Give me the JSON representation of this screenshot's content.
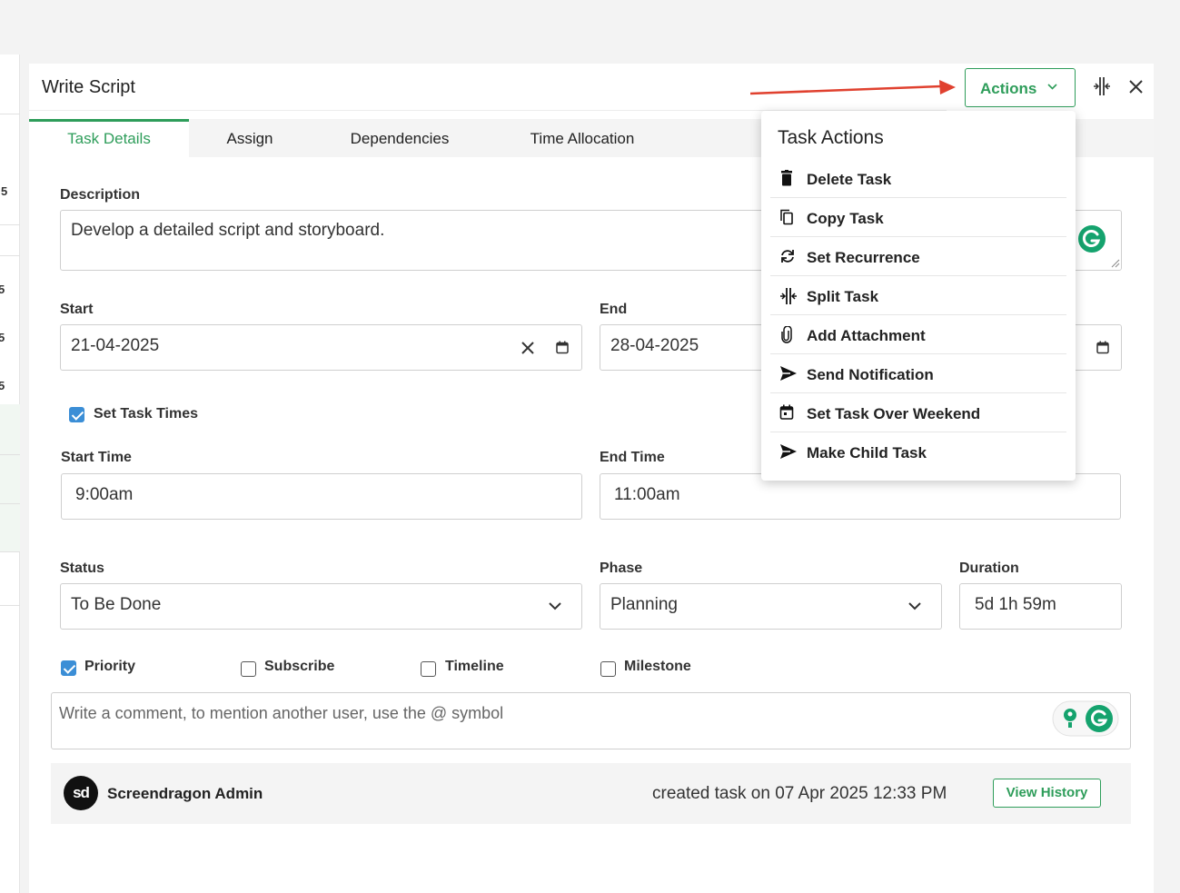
{
  "background_list": {
    "row_values": [
      "5",
      "5",
      "5",
      "5"
    ]
  },
  "panel": {
    "title": "Write Script"
  },
  "header_actions": {
    "actions_label": "Actions",
    "split_icon": "split-icon",
    "close_icon": "close-icon"
  },
  "tabs": [
    {
      "label": "Task Details",
      "active": true
    },
    {
      "label": "Assign",
      "active": false
    },
    {
      "label": "Dependencies",
      "active": false
    },
    {
      "label": "Time Allocation",
      "active": false
    }
  ],
  "form": {
    "description_label": "Description",
    "description_value": "Develop a detailed script and storyboard.",
    "start_label": "Start",
    "start_value": "21-04-2025",
    "end_label": "End",
    "end_value": "28-04-2025",
    "set_task_times_label": "Set Task Times",
    "set_task_times_checked": true,
    "start_time_label": "Start Time",
    "start_time_value": "9:00am",
    "end_time_label": "End Time",
    "end_time_value": "11:00am",
    "status_label": "Status",
    "status_value": "To Be Done",
    "phase_label": "Phase",
    "phase_value": "Planning",
    "duration_label": "Duration",
    "duration_value": "5d 1h 59m",
    "priority_label": "Priority",
    "priority_checked": true,
    "subscribe_label": "Subscribe",
    "subscribe_checked": false,
    "timeline_label": "Timeline",
    "timeline_checked": false,
    "milestone_label": "Milestone",
    "milestone_checked": false,
    "comment_placeholder": "Write a comment, to mention another user, use the @ symbol"
  },
  "history": {
    "avatar_text": "sd",
    "user": "Screendragon Admin",
    "created_text": "created task on  07 Apr 2025 12:33 PM",
    "view_history_label": "View History"
  },
  "task_actions": {
    "title": "Task Actions",
    "items": [
      {
        "label": "Delete Task",
        "icon": "trash-icon"
      },
      {
        "label": "Copy Task",
        "icon": "copy-icon"
      },
      {
        "label": "Set Recurrence",
        "icon": "recurrence-icon"
      },
      {
        "label": "Split Task",
        "icon": "split-icon"
      },
      {
        "label": "Add Attachment",
        "icon": "paperclip-icon"
      },
      {
        "label": "Send Notification",
        "icon": "send-icon"
      },
      {
        "label": "Set Task Over Weekend",
        "icon": "calendar-icon"
      },
      {
        "label": "Make Child Task",
        "icon": "send-icon"
      }
    ]
  },
  "colors": {
    "accent_green": "#2e9d5a",
    "checkbox_blue": "#3b8ed6",
    "arrow_red": "#e0412f",
    "grammarly_green": "#15a36e"
  }
}
